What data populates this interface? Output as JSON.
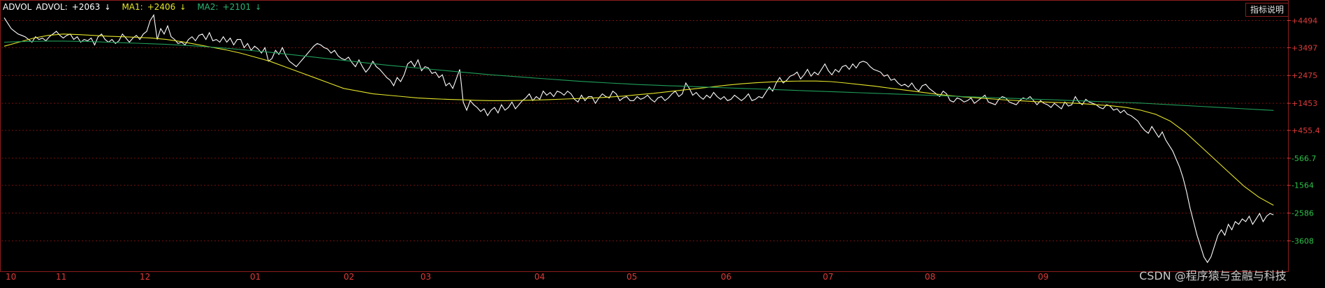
{
  "legend": {
    "indicator": "ADVOL",
    "advol_label": "ADVOL:",
    "advol_value": "+2063",
    "advol_arrow": "↓",
    "ma1_label": "MA1:",
    "ma1_value": "+2406",
    "ma1_arrow": "↓",
    "ma2_label": "MA2:",
    "ma2_value": "+2101",
    "ma2_arrow": "↓"
  },
  "help_button": "指标说明",
  "watermark": "CSDN @程序猿与金融与科技",
  "colors": {
    "advol": "#ffffff",
    "ma1": "#e5e52a",
    "ma2": "#1f9e5a",
    "grid": "#7a1010",
    "positive": "#e03a3a",
    "negative": "#2ec04a"
  },
  "chart_data": {
    "type": "line",
    "x": [
      "10",
      "11",
      "12",
      "01",
      "02",
      "03",
      "04",
      "05",
      "06",
      "07",
      "08",
      "09"
    ],
    "y_ticks": [
      {
        "label": "+4494",
        "value": 4494,
        "sign": "pos"
      },
      {
        "label": "+3497",
        "value": 3497,
        "sign": "pos"
      },
      {
        "label": "+2475",
        "value": 2475,
        "sign": "pos"
      },
      {
        "label": "+1453",
        "value": 1453,
        "sign": "pos"
      },
      {
        "label": "+455.4",
        "value": 455.4,
        "sign": "pos"
      },
      {
        "label": "-566.7",
        "value": -566.7,
        "sign": "neg"
      },
      {
        "label": "-1564",
        "value": -1564,
        "sign": "neg"
      },
      {
        "label": "-2586",
        "value": -2586,
        "sign": "neg"
      },
      {
        "label": "-3608",
        "value": -3608,
        "sign": "neg"
      }
    ],
    "ylim": [
      -4700,
      5200
    ],
    "series": [
      {
        "name": "ADVOL",
        "values": [
          4600,
          4400,
          4200,
          4100,
          4000,
          3950,
          3900,
          3800,
          3700,
          3900,
          3800,
          3850,
          3750,
          3900,
          4000,
          4100,
          3950,
          3850,
          3950,
          4000,
          3800,
          3900,
          3700,
          3800,
          3750,
          3850,
          3600,
          3900,
          4000,
          3800,
          3700,
          3800,
          3650,
          3750,
          4000,
          3850,
          3700,
          3850,
          3950,
          3800,
          4000,
          4100,
          4500,
          4700,
          3800,
          4200,
          4000,
          4300,
          3900,
          3800,
          3650,
          3700,
          3600,
          3800,
          3900,
          3750,
          3950,
          4000,
          3800,
          4050,
          3750,
          3800,
          3700,
          3900,
          3700,
          3850,
          3600,
          3800,
          3800,
          3500,
          3650,
          3400,
          3550,
          3450,
          3300,
          3500,
          3000,
          3100,
          3400,
          3250,
          3500,
          3200,
          3000,
          2900,
          2800,
          2950,
          3100,
          3250,
          3400,
          3550,
          3650,
          3600,
          3500,
          3450,
          3300,
          3400,
          3200,
          3100,
          3050,
          3150,
          2950,
          2800,
          3050,
          2800,
          2600,
          2750,
          3000,
          2800,
          2700,
          2550,
          2400,
          2300,
          2100,
          2400,
          2250,
          2500,
          2900,
          3000,
          2800,
          3050,
          2650,
          2800,
          2750,
          2550,
          2600,
          2400,
          2500,
          2100,
          2200,
          2000,
          2350,
          2700,
          1500,
          1200,
          1550,
          1400,
          1300,
          1150,
          1250,
          1000,
          1200,
          1300,
          1100,
          1400,
          1200,
          1300,
          1500,
          1250,
          1400,
          1550,
          1650,
          1800,
          1550,
          1700,
          1600,
          1900,
          1750,
          1850,
          1700,
          1900,
          1850,
          1750,
          1900,
          1800,
          1600,
          1500,
          1750,
          1550,
          1700,
          1700,
          1450,
          1650,
          1800,
          1700,
          1650,
          1900,
          1800,
          1550,
          1650,
          1700,
          1550,
          1550,
          1700,
          1600,
          1650,
          1750,
          1600,
          1500,
          1650,
          1700,
          1550,
          1650,
          1800,
          1900,
          1700,
          1800,
          2200,
          2000,
          1750,
          1850,
          1700,
          1600,
          1750,
          1650,
          1850,
          1700,
          1600,
          1700,
          1550,
          1600,
          1750,
          1650,
          1550,
          1650,
          1800,
          1550,
          1600,
          1700,
          1650,
          1850,
          2050,
          1900,
          2200,
          2400,
          2200,
          2300,
          2450,
          2500,
          2600,
          2350,
          2500,
          2700,
          2450,
          2600,
          2500,
          2700,
          2900,
          2650,
          2500,
          2700,
          2600,
          2800,
          2850,
          2700,
          2900,
          2750,
          2950,
          3000,
          2950,
          2800,
          2700,
          2650,
          2600,
          2450,
          2500,
          2300,
          2350,
          2200,
          2100,
          2150,
          2050,
          2200,
          2000,
          1900,
          2100,
          2150,
          2000,
          1900,
          1800,
          1700,
          1900,
          1800,
          1550,
          1500,
          1650,
          1600,
          1500,
          1550,
          1650,
          1450,
          1550,
          1650,
          1750,
          1500,
          1450,
          1400,
          1600,
          1700,
          1650,
          1500,
          1450,
          1400,
          1550,
          1650,
          1600,
          1700,
          1550,
          1400,
          1550,
          1450,
          1400,
          1300,
          1450,
          1350,
          1250,
          1500,
          1350,
          1400,
          1700,
          1500,
          1400,
          1600,
          1500,
          1450,
          1400,
          1300,
          1250,
          1400,
          1350,
          1200,
          1250,
          1100,
          1200,
          1050,
          1000,
          900,
          800,
          600,
          450,
          350,
          600,
          400,
          200,
          400,
          100,
          -100,
          -300,
          -600,
          -900,
          -1300,
          -1800,
          -2400,
          -2900,
          -3400,
          -3800,
          -4200,
          -4400,
          -4200,
          -3800,
          -3400,
          -3200,
          -3400,
          -3000,
          -3200,
          -2900,
          -3000,
          -2800,
          -2900,
          -2700,
          -3000,
          -2800,
          -2600,
          -2900,
          -2700,
          -2600,
          -2650
        ]
      },
      {
        "name": "MA1",
        "values": [
          3550,
          3700,
          3850,
          3950,
          4000,
          3980,
          3950,
          3920,
          3900,
          3880,
          3850,
          3800,
          3720,
          3620,
          3520,
          3420,
          3300,
          3150,
          3000,
          2800,
          2600,
          2400,
          2200,
          2000,
          1900,
          1800,
          1750,
          1700,
          1650,
          1620,
          1600,
          1580,
          1560,
          1550,
          1550,
          1560,
          1570,
          1590,
          1610,
          1630,
          1650,
          1680,
          1720,
          1770,
          1820,
          1880,
          1940,
          2000,
          2060,
          2120,
          2170,
          2210,
          2240,
          2260,
          2270,
          2270,
          2250,
          2200,
          2140,
          2080,
          2010,
          1940,
          1870,
          1800,
          1740,
          1690,
          1650,
          1610,
          1570,
          1540,
          1510,
          1490,
          1470,
          1440,
          1400,
          1360,
          1300,
          1200,
          1050,
          800,
          400,
          -100,
          -600,
          -1100,
          -1600,
          -2000,
          -2300
        ]
      },
      {
        "name": "MA2",
        "values": [
          3700,
          3720,
          3730,
          3740,
          3740,
          3730,
          3720,
          3700,
          3680,
          3660,
          3640,
          3620,
          3590,
          3560,
          3520,
          3480,
          3430,
          3380,
          3330,
          3270,
          3210,
          3150,
          3090,
          3030,
          2970,
          2910,
          2850,
          2800,
          2750,
          2700,
          2650,
          2600,
          2550,
          2500,
          2460,
          2420,
          2380,
          2340,
          2300,
          2260,
          2230,
          2200,
          2170,
          2140,
          2120,
          2100,
          2080,
          2060,
          2040,
          2020,
          2000,
          1980,
          1960,
          1940,
          1920,
          1900,
          1880,
          1860,
          1840,
          1820,
          1800,
          1780,
          1760,
          1740,
          1720,
          1700,
          1680,
          1660,
          1640,
          1620,
          1600,
          1580,
          1560,
          1540,
          1520,
          1500,
          1480,
          1460,
          1430,
          1400,
          1370,
          1340,
          1310,
          1280,
          1250,
          1220,
          1190
        ]
      }
    ]
  }
}
